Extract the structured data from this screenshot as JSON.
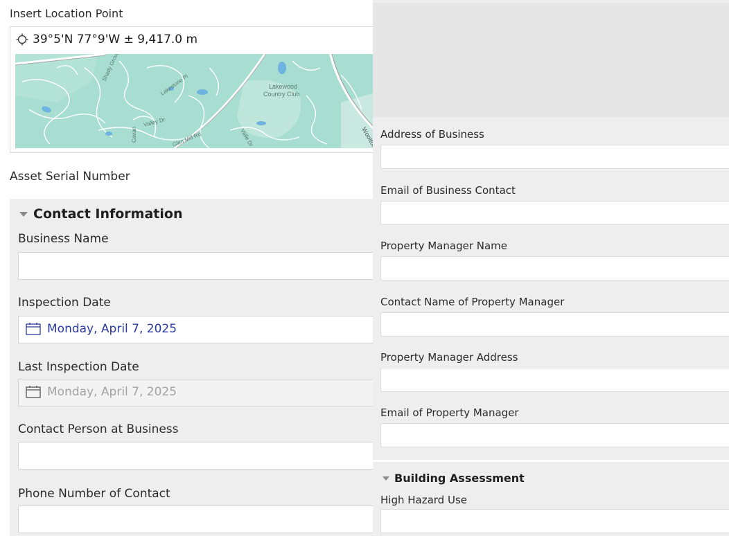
{
  "location": {
    "label": "Insert Location Point",
    "coordinates": "39°5'N 77°9'W ± 9,417.0 m",
    "map_labels": {
      "place": "Lakewood",
      "place2": "Country Club",
      "road1": "Shady Grove",
      "road2": "Lakestone Pl",
      "road3": "Valley Dr",
      "road4": "Glen Mill Rd",
      "road5": "Valle Dr",
      "road6": "Wootton",
      "road7": "Cavan"
    }
  },
  "asset_serial": {
    "label": "Asset Serial Number"
  },
  "contact_group": {
    "title": "Contact Information",
    "business_name": {
      "label": "Business Name",
      "value": ""
    },
    "inspection_date": {
      "label": "Inspection Date",
      "value": "Monday, April 7, 2025"
    },
    "last_inspection_date": {
      "label": "Last Inspection Date",
      "value": "Monday, April 7, 2025"
    },
    "contact_person": {
      "label": "Contact Person at Business",
      "value": ""
    },
    "phone_number": {
      "label": "Phone Number of Contact",
      "value": ""
    }
  },
  "right_fields": {
    "address_of_business": {
      "label": "Address of Business",
      "value": ""
    },
    "email_business_contact": {
      "label": "Email of Business Contact",
      "value": ""
    },
    "property_manager_name": {
      "label": "Property Manager Name",
      "value": ""
    },
    "contact_name_property_manager": {
      "label": "Contact Name of Property Manager",
      "value": ""
    },
    "property_manager_address": {
      "label": "Property Manager Address",
      "value": ""
    },
    "email_property_manager": {
      "label": "Email of Property Manager",
      "value": ""
    }
  },
  "building_group": {
    "title": "Building Assessment",
    "high_hazard_use": {
      "label": "High Hazard Use",
      "value": ""
    }
  },
  "colors": {
    "date_active": "#2b3aa0",
    "date_disabled": "#a3a3a3",
    "map_water": "#a8ded1",
    "panel_bg": "#eeeeee"
  },
  "icons": {
    "crosshair": "crosshair-icon",
    "calendar": "calendar-icon",
    "collapse": "triangle-down-icon"
  }
}
